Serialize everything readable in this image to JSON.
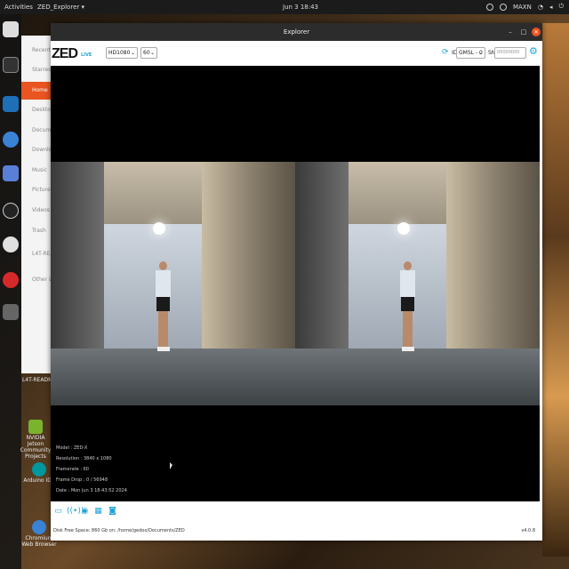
{
  "topbar": {
    "activities": "Activities",
    "app_menu": "ZED_Explorer ▾",
    "clock": "Jun 3  18:43",
    "tray_label": "MAXN",
    "tray_icons": [
      "cpu-icon",
      "chrome-icon",
      "wifi-icon",
      "volume-icon",
      "power-icon"
    ]
  },
  "dock": {
    "icons": [
      "files-icon",
      "terminal-icon",
      "vscode-icon",
      "chromium-icon",
      "screenshot-icon",
      "obs-icon",
      "store-icon",
      "help-icon",
      "apps-icon"
    ]
  },
  "desktop": {
    "items": [
      {
        "label": "L4T-README"
      },
      {
        "label": "NVIDIA Jetson Community Projects"
      },
      {
        "label": "Arduino IDE"
      },
      {
        "label": "Chromium Web Browser"
      }
    ]
  },
  "file_manager": {
    "items": [
      "Recent",
      "Starred",
      "Home",
      "Desktop",
      "Documents",
      "Downloads",
      "Music",
      "Pictures",
      "Videos",
      "Trash",
      "L4T-README",
      "Other Locations"
    ],
    "active_index": 2
  },
  "window": {
    "title": "Explorer",
    "minimize": "–",
    "maximize": "□",
    "close": "×"
  },
  "toolbar": {
    "logo": "ZED",
    "live_badge": "LIVE",
    "resolution": "HD1080",
    "fps": "60",
    "id_label": "ID",
    "id_value": "GMSL - 0",
    "sn_label": "SN",
    "sn_placeholder": "00000000"
  },
  "overlay": {
    "model": "Model : ZED-X",
    "resolution": "Resolution : 3840 x 1080",
    "framerate": "Framerate : 60",
    "frame_drop": "Frame Drop : 0 / 56948",
    "date": "Date : Mon Jun 3 18:43:52 2024"
  },
  "bottom_tools": [
    "folder-icon",
    "stream-icon",
    "sensor-icon",
    "video-icon",
    "snapshot-icon"
  ],
  "status": {
    "disk": "Disk Free Space: 860 Gb  on: /home/gedoo/Documents/ZED",
    "version": "v4.0.8"
  },
  "colors": {
    "accent": "#1fa4d8",
    "ubuntu_orange": "#e95420",
    "titlebar": "#2c2c2c"
  }
}
